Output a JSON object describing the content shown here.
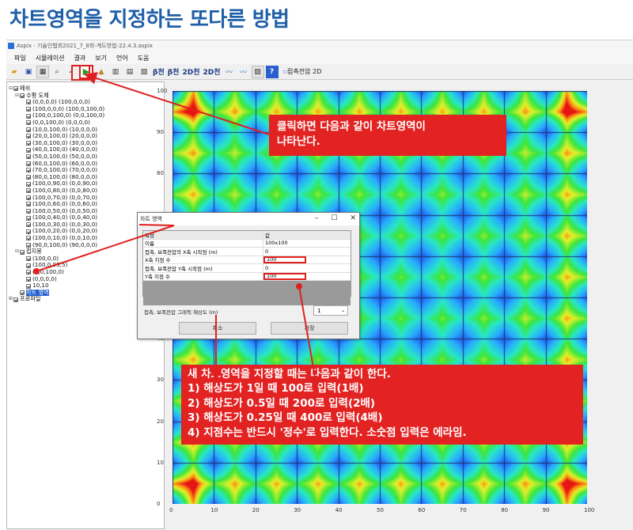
{
  "heading": "차트영역을 지정하는 또다른 방법",
  "window": {
    "title": "Aspix - 기술인협회2021_7_8회-계도방법-22.4.3.aspix"
  },
  "menu": [
    "파일",
    "시뮬레이션",
    "결과",
    "보기",
    "언어",
    "도움"
  ],
  "toolbar": {
    "text_buttons": [
      "β천",
      "β천",
      "2D천",
      "2D천"
    ],
    "help": "?"
  },
  "chart_title": "접촉전압 2D",
  "tree": [
    {
      "label": "메쉬",
      "level": 0,
      "expander": "⊟"
    },
    {
      "label": "수평 도체",
      "level": 1,
      "expander": "⊟"
    },
    {
      "label": "(0,0,0,0) (100,0,0,0)",
      "level": 2
    },
    {
      "label": "(100,0,0,0) (100,0,100,0)",
      "level": 2
    },
    {
      "label": "(100,0,100,0) (0,0,100,0)",
      "level": 2
    },
    {
      "label": "(0,0,100,0) (0,0,0,0)",
      "level": 2
    },
    {
      "label": "(10,0,100,0) (10,0,0,0)",
      "level": 2
    },
    {
      "label": "(20,0,100,0) (20,0,0,0)",
      "level": 2
    },
    {
      "label": "(30,0,100,0) (30,0,0,0)",
      "level": 2
    },
    {
      "label": "(40,0,100,0) (40,0,0,0)",
      "level": 2
    },
    {
      "label": "(50,0,100,0) (50,0,0,0)",
      "level": 2
    },
    {
      "label": "(60,0,100,0) (60,0,0,0)",
      "level": 2
    },
    {
      "label": "(70,0,100,0) (70,0,0,0)",
      "level": 2
    },
    {
      "label": "(80,0,100,0) (80,0,0,0)",
      "level": 2
    },
    {
      "label": "(100,0,90,0) (0,0,90,0)",
      "level": 2
    },
    {
      "label": "(100,0,80,0) (0,0,80,0)",
      "level": 2
    },
    {
      "label": "(100,0,70,0) (0,0,70,0)",
      "level": 2
    },
    {
      "label": "(100,0,60,0) (0,0,60,0)",
      "level": 2
    },
    {
      "label": "(100,0,50,0) (0,0,50,0)",
      "level": 2
    },
    {
      "label": "(100,0,40,0) (0,0,40,0)",
      "level": 2
    },
    {
      "label": "(100,0,30,0) (0,0,30,0)",
      "level": 2
    },
    {
      "label": "(100,0,20,0) (0,0,20,0)",
      "level": 2
    },
    {
      "label": "(100,0,10,0) (0,0,10,0)",
      "level": 2
    },
    {
      "label": "(90,0,100,0) (90,0,0,0)",
      "level": 2
    },
    {
      "label": "접지봉",
      "level": 1,
      "expander": "⊟"
    },
    {
      "label": "(100,0,0)",
      "level": 2
    },
    {
      "label": "(100,0,99,5)",
      "level": 2
    },
    {
      "label": "(0,0,100,0)",
      "level": 2
    },
    {
      "label": "(0,0,0,0)",
      "level": 2
    },
    {
      "label": "10,10",
      "level": 2
    },
    {
      "label": "차트 영역",
      "level": 1,
      "selected": true
    },
    {
      "label": "프로파일",
      "level": 0,
      "expander": "⊞"
    }
  ],
  "dialog": {
    "title": "차트 영역",
    "col_headers": [
      "특성",
      "값"
    ],
    "rows": [
      {
        "label": "이름",
        "value": "100x100"
      },
      {
        "label": "접촉, 보폭전압의 X축 시작점 (m)",
        "value": "0"
      },
      {
        "label": "X축 지점 수",
        "value": "100",
        "highlight": true
      },
      {
        "label": "접촉, 보폭전압 Y축 시작점 (m)",
        "value": "0"
      },
      {
        "label": "Y축 지점 수",
        "value": "100",
        "highlight": true
      }
    ],
    "resolution_label": "접촉, 보폭전압 그래픽 해상도 (m)",
    "resolution_value": "1",
    "cancel": "취소",
    "save": "저장"
  },
  "callout_top": [
    "클릭하면 다음과 같이 차트영역이",
    "나타난다."
  ],
  "callout_bottom": [
    "새 차트영역을 지정할 때는 다음과 같이 한다.",
    "1) 해상도가 1일 때 100로 입력(1배)",
    "2) 해상도가 0.5일 때 200로 입력(2배)",
    "3) 해상도가 0.25일 때 400로 입력(4배)",
    "4) 지점수는 반드시 '정수'로 입력한다. 소숫점 입력은 에라임."
  ],
  "colors": {
    "accent": "#e32222",
    "heading": "#1f5fa8"
  },
  "chart_data": {
    "type": "heatmap",
    "title": "접촉전압 2D",
    "xlim": [
      0,
      100
    ],
    "ylim": [
      0,
      100
    ],
    "x_ticks": [
      0,
      10,
      20,
      30,
      40,
      50,
      60,
      70,
      80,
      90,
      100
    ],
    "y_ticks": [
      0,
      10,
      20,
      30,
      40,
      50,
      60,
      70,
      80,
      90,
      100
    ],
    "grid_lines_x": [
      0,
      10,
      20,
      30,
      40,
      50,
      60,
      70,
      80,
      90,
      100
    ],
    "grid_lines_y": [
      0,
      10,
      20,
      30,
      40,
      50,
      60,
      70,
      80,
      90,
      100
    ]
  }
}
